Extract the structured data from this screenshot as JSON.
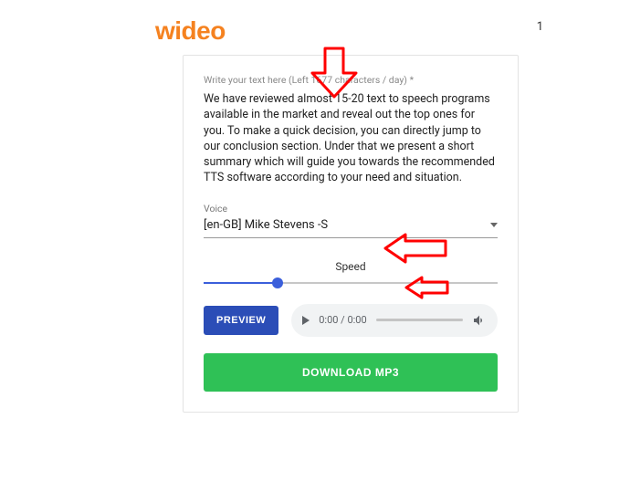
{
  "header": {
    "logo_text": "wideo",
    "top_right": "1"
  },
  "textInput": {
    "label": "Write your text here (Left 1677 characters / day) *",
    "value": "We have reviewed almost 15-20 text to speech programs available in the market and reveal out the top ones for you. To make a quick decision, you can directly jump to our conclusion section. Under that we present a short summary which will guide you towards the recommended TTS software according to your need and situation."
  },
  "voice": {
    "label": "Voice",
    "selected": "[en-GB] Mike Stevens -S"
  },
  "speed": {
    "label": "Speed",
    "value_percent": 25
  },
  "buttons": {
    "preview": "PREVIEW",
    "download": "DOWNLOAD MP3"
  },
  "audio": {
    "time": "0:00 / 0:00"
  }
}
